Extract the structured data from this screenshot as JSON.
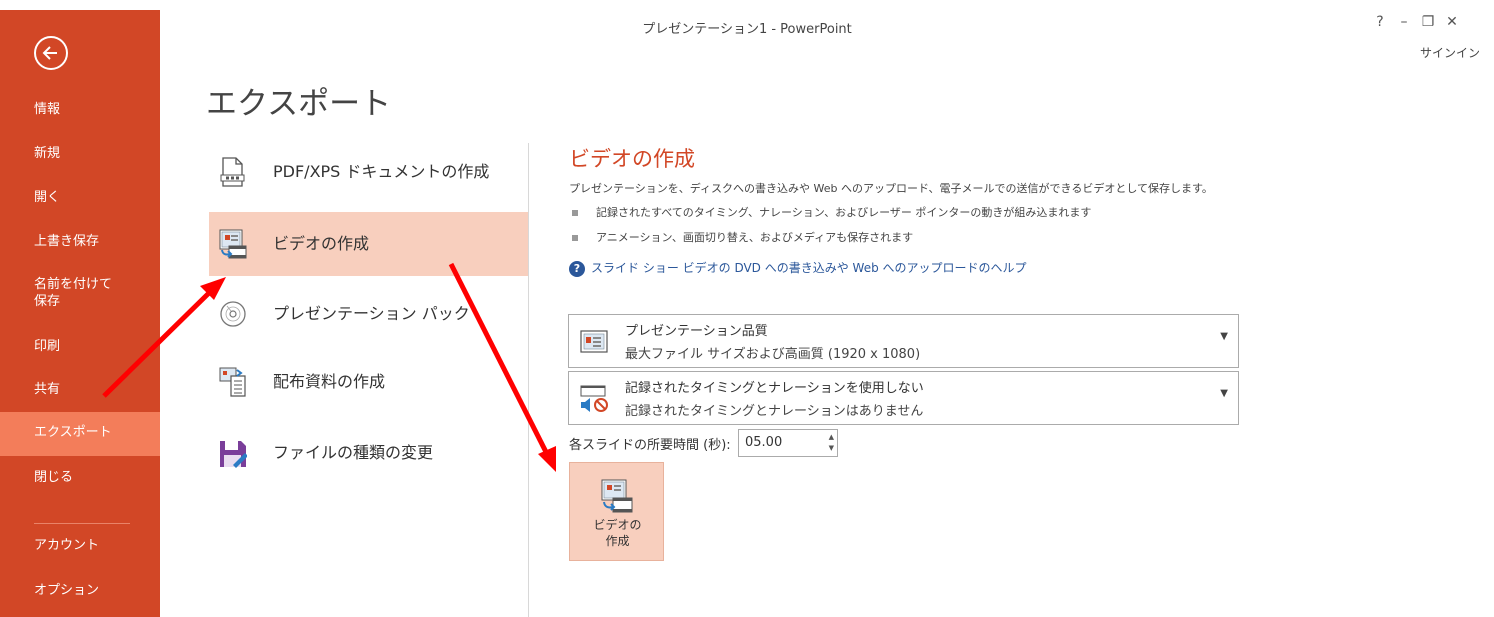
{
  "window": {
    "title": "プレゼンテーション1 - PowerPoint",
    "help": "?",
    "minimize": "–",
    "restore": "❐",
    "close": "✕",
    "signin": "サインイン"
  },
  "sidebar": {
    "items": [
      {
        "label": "情報"
      },
      {
        "label": "新規"
      },
      {
        "label": "開く"
      },
      {
        "label": "上書き保存"
      },
      {
        "label": "名前を付けて\n保存"
      },
      {
        "label": "印刷"
      },
      {
        "label": "共有"
      },
      {
        "label": "エクスポート"
      },
      {
        "label": "閉じる"
      },
      {
        "label": "アカウント"
      },
      {
        "label": "オプション"
      }
    ],
    "active": "エクスポート",
    "colors": {
      "background": "#D24726",
      "active": "#F37D5A"
    }
  },
  "page": {
    "title": "エクスポート"
  },
  "options": [
    {
      "label": "PDF/XPS ドキュメントの作成",
      "icon": "pdf-document-icon"
    },
    {
      "label": "ビデオの作成",
      "icon": "video-create-icon"
    },
    {
      "label": "プレゼンテーション パック",
      "icon": "cd-package-icon"
    },
    {
      "label": "配布資料の作成",
      "icon": "handouts-icon"
    },
    {
      "label": "ファイルの種類の変更",
      "icon": "save-file-type-icon"
    }
  ],
  "detail": {
    "title": "ビデオの作成",
    "description": "プレゼンテーションを、ディスクへの書き込みや Web へのアップロード、電子メールでの送信ができるビデオとして保存します。",
    "bullets": [
      "記録されたすべてのタイミング、ナレーション、およびレーザー ポインターの動きが組み込まれます",
      "アニメーション、画面切り替え、およびメディアも保存されます"
    ],
    "help_link": "スライド ショー ビデオの DVD への書き込みや Web へのアップロードのヘルプ",
    "quality": {
      "title": "プレゼンテーション品質",
      "subtitle": "最大ファイル サイズおよび高画質 (1920 x 1080)"
    },
    "timing": {
      "title": "記録されたタイミングとナレーションを使用しない",
      "subtitle": "記録されたタイミングとナレーションはありません"
    },
    "seconds_label": "各スライドの所要時間 (秒):",
    "seconds_value": "05.00",
    "create_button": "ビデオの\n作成"
  },
  "accent_color": "#D24726",
  "annotation_color": "#FF0000"
}
